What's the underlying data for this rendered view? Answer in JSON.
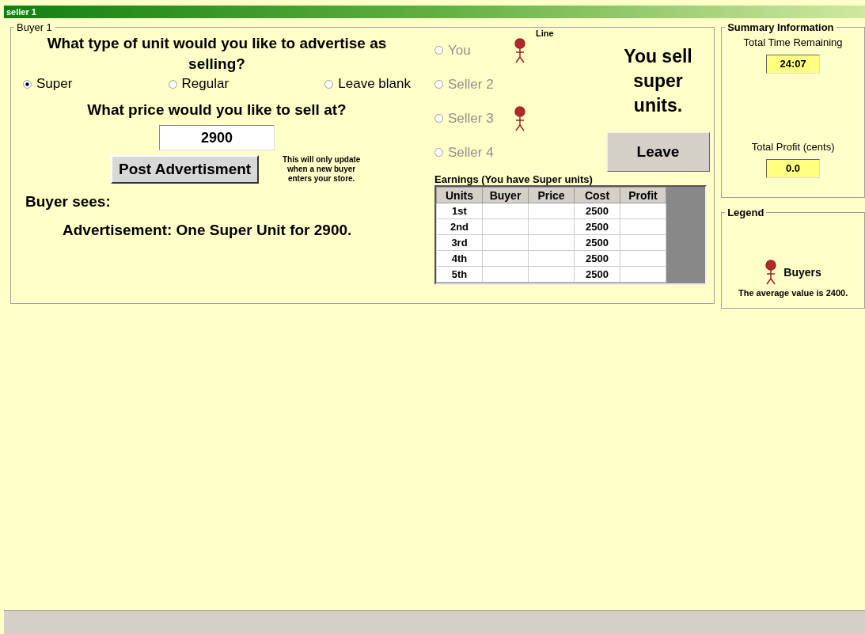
{
  "window": {
    "title": "seller 1"
  },
  "buyer_panel": {
    "legend": "Buyer 1",
    "question": "What type of unit would you like to advertise as selling?",
    "unit_options": [
      {
        "label": "Super",
        "selected": true
      },
      {
        "label": "Regular",
        "selected": false
      },
      {
        "label": "Leave blank",
        "selected": false
      }
    ],
    "price_question": "What price would you like to sell at?",
    "price": "2900",
    "post_button": "Post Advertisment",
    "note": "This will only update when a new buyer enters your store.",
    "buyer_sees_label": "Buyer sees:",
    "advertisement": "Advertisement: One Super Unit for 2900."
  },
  "line": {
    "label": "Line",
    "sellers": [
      {
        "label": "You",
        "selected": false,
        "disabled": true,
        "buyer": true
      },
      {
        "label": "Seller 2",
        "selected": false,
        "disabled": true,
        "buyer": false
      },
      {
        "label": "Seller 3",
        "selected": false,
        "disabled": true,
        "buyer": true
      },
      {
        "label": "Seller 4",
        "selected": false,
        "disabled": true,
        "buyer": false
      }
    ]
  },
  "sell_message": "You sell super units.",
  "leave_button": "Leave",
  "earnings": {
    "title": "Earnings (You have Super units)",
    "columns": [
      "Units",
      "Buyer",
      "Price",
      "Cost",
      "Profit"
    ],
    "rows": [
      [
        "1st",
        "",
        "",
        "2500",
        ""
      ],
      [
        "2nd",
        "",
        "",
        "2500",
        ""
      ],
      [
        "3rd",
        "",
        "",
        "2500",
        ""
      ],
      [
        "4th",
        "",
        "",
        "2500",
        ""
      ],
      [
        "5th",
        "",
        "",
        "2500",
        ""
      ]
    ]
  },
  "summary": {
    "legend": "Summary Information",
    "time_label": "Total Time Remaining",
    "time": "24:07",
    "profit_label": "Total Profit (cents)",
    "profit": "0.0"
  },
  "legend_panel": {
    "legend": "Legend",
    "buyers_label": "Buyers",
    "average_note": "The average value is 2400."
  }
}
